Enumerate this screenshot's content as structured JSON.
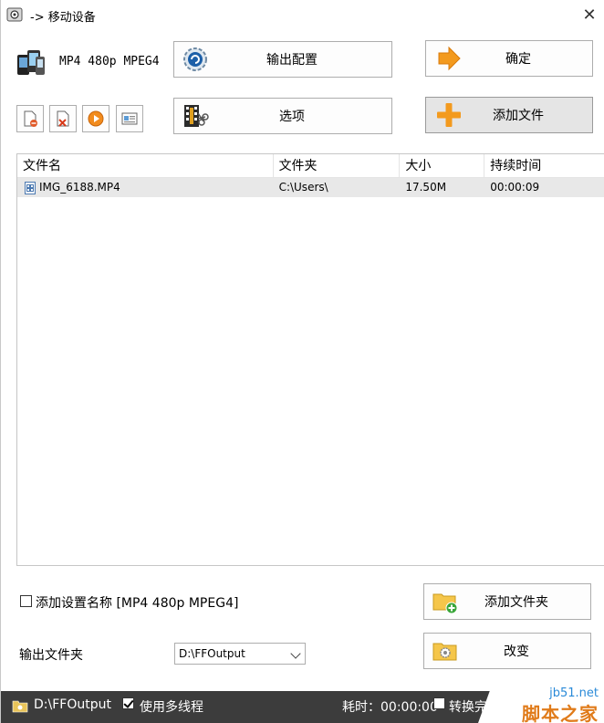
{
  "window": {
    "title": "-> 移动设备",
    "close_glyph": "✕"
  },
  "profile": {
    "label": "MP4 480p MPEG4",
    "icon": "phones-icon"
  },
  "buttons": {
    "output_config": "输出配置",
    "ok": "确定",
    "options": "选项",
    "add_file": "添加文件",
    "add_folder": "添加文件夹",
    "change": "改变"
  },
  "toolbar_icons": [
    "remove-file-icon",
    "clear-list-icon",
    "play-icon",
    "media-info-icon"
  ],
  "file_list": {
    "columns": [
      "文件名",
      "文件夹",
      "大小",
      "持续时间"
    ],
    "rows": [
      {
        "name": "IMG_6188.MP4",
        "folder": "C:\\Users\\",
        "size": "17.50M",
        "duration": "00:00:09"
      }
    ]
  },
  "settings": {
    "add_name_label": "添加设置名称 [MP4 480p MPEG4]",
    "add_name_checked": false,
    "output_folder_label": "输出文件夹",
    "output_folder_value": "D:\\FFOutput"
  },
  "status": {
    "path": "D:\\FFOutput",
    "multithread_label": "使用多线程",
    "multithread_checked": true,
    "elapsed": "耗时：00:00:00",
    "convert_label": "转换完"
  },
  "watermark": {
    "line1": "jb51.net",
    "line2": "脚本之家"
  },
  "colors": {
    "status_bg": "#3c3c3c",
    "row_selected": "#e8e8e8",
    "add_icon": "#f39a1e",
    "ok_icon": "#f39a1e"
  }
}
